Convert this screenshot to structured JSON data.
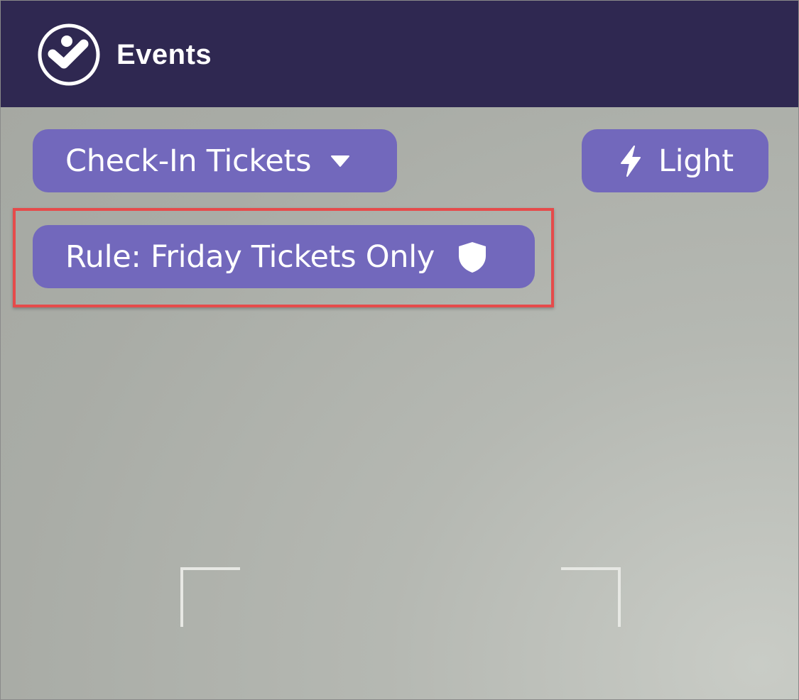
{
  "header": {
    "app_title": "Events",
    "logo_icon": "checkmark-person-icon",
    "background_color": "#2f2851"
  },
  "controls": {
    "ticket_selector": {
      "label": "Check-In Tickets",
      "icon": "caret-down-icon"
    },
    "light_toggle": {
      "label": "Light",
      "icon": "lightning-bolt-icon"
    },
    "rule_badge": {
      "label": "Rule: Friday Tickets Only",
      "icon": "shield-icon"
    },
    "pill_color": "#7268bc"
  },
  "highlight": {
    "color": "#e54b4b"
  },
  "scanner": {
    "frame_color": "#e7e8e4"
  }
}
